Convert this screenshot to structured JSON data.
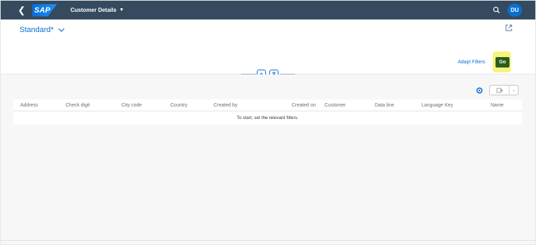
{
  "shell": {
    "logo_text": "SAP",
    "app_title": "Customer Details",
    "user_initials": "DU",
    "brand_color": "#354a5f",
    "accent_color": "#0a6ed1"
  },
  "header": {
    "variant_name": "Standard*",
    "adapt_filters_label": "Adapt Filters",
    "go_label": "Go",
    "go_color": "#2b5e1c",
    "highlight_color": "#f7f37b"
  },
  "table": {
    "columns": [
      "Address",
      "Check digit",
      "City code",
      "Country",
      "Created by",
      "Created on",
      "Customer",
      "Data line",
      "Language Key",
      "Name"
    ],
    "empty_text": "To start, set the relevant filters."
  },
  "icons": [
    "back-icon",
    "search-icon",
    "share-icon",
    "collapse-header-icon",
    "pin-header-icon",
    "settings-icon",
    "export-icon",
    "chevron-down-icon"
  ]
}
